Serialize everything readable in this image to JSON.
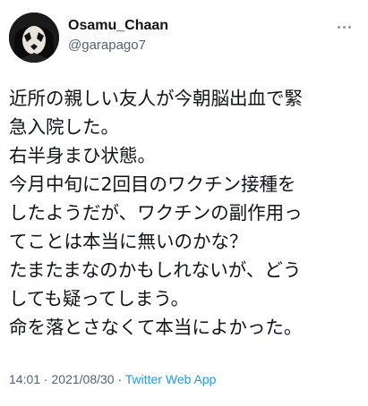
{
  "user": {
    "display_name": "Osamu_Chaan",
    "handle": "@garapago7",
    "avatar_icon": "face-paint-avatar"
  },
  "more_icon": "more-horizontal-icon",
  "tweet": {
    "lines": [
      "近所の親しい友人が今朝脳出血で緊",
      "急入院した。",
      "右半身まひ状態。",
      "今月中旬に2回目のワクチン接種を",
      "したようだが、ワクチンの副作用っ",
      "てことは本当に無いのかな？",
      "たまたまなのかもしれないが、どう",
      "しても疑ってしまう。",
      "命を落とさなくて本当によかった。"
    ]
  },
  "meta": {
    "time": "14:01",
    "sep1": " · ",
    "date": "2021/08/30",
    "sep2": " · ",
    "app": "Twitter Web App"
  },
  "colors": {
    "text": "#0f1419",
    "secondary": "#536471",
    "link": "#1d9bf0"
  }
}
